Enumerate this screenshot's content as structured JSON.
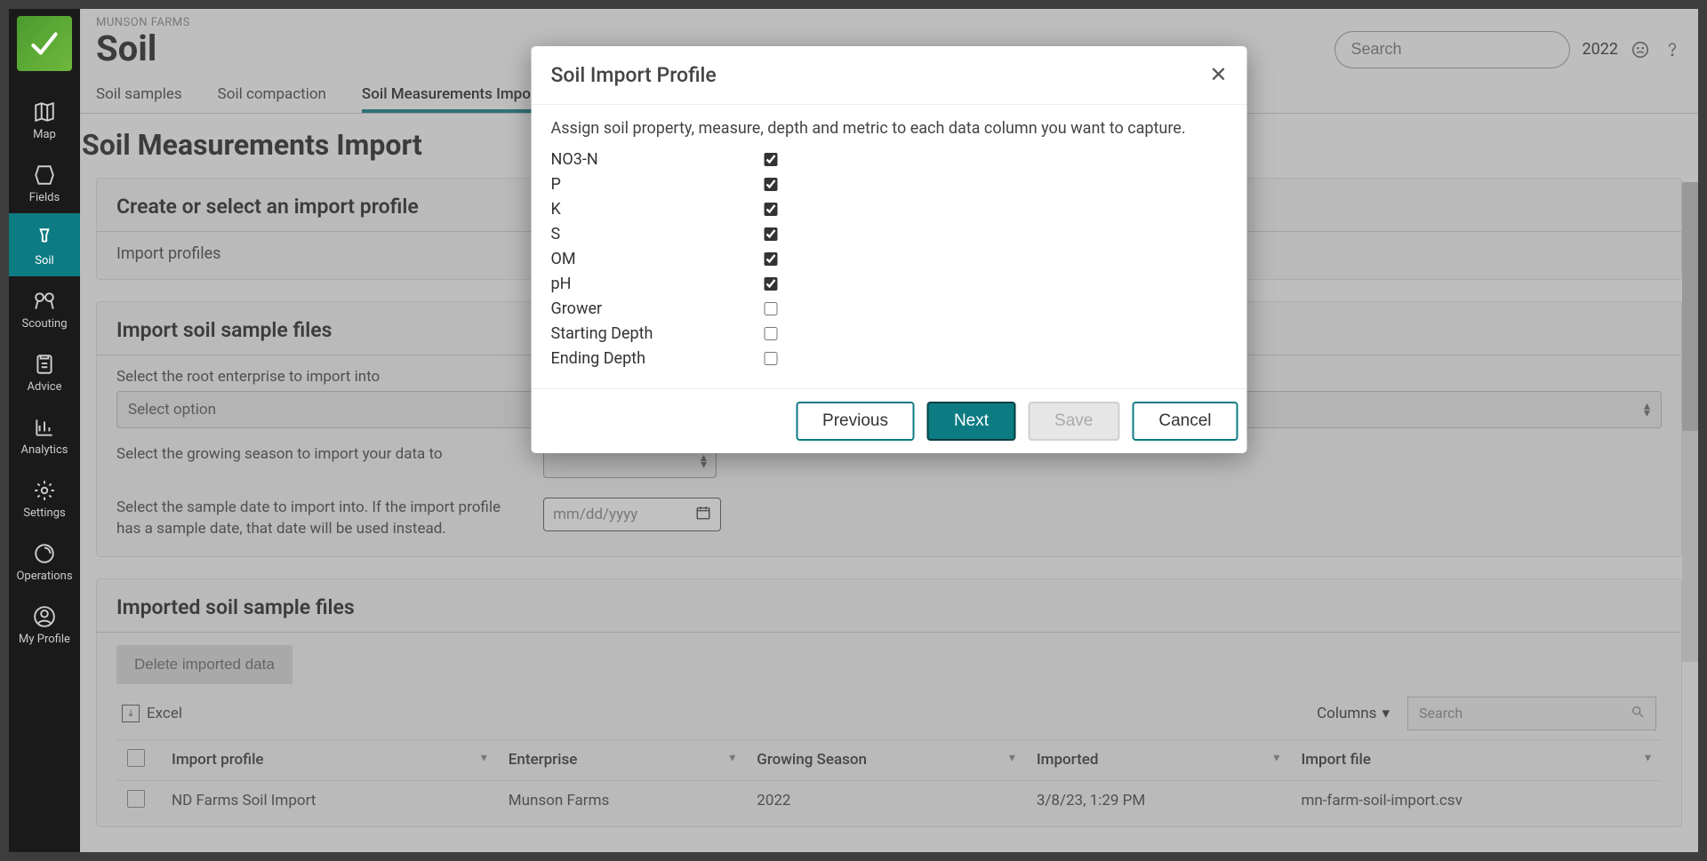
{
  "farmName": "MUNSON FARMS",
  "pageTitle": "Soil",
  "search": {
    "placeholder": "Search",
    "year": "2022"
  },
  "nav": {
    "map": "Map",
    "fields": "Fields",
    "soil": "Soil",
    "scouting": "Scouting",
    "advice": "Advice",
    "analytics": "Analytics",
    "settings": "Settings",
    "operations": "Operations",
    "myprofile": "My Profile"
  },
  "tabs": {
    "samples": "Soil samples",
    "compaction": "Soil compaction",
    "measurements": "Soil Measurements Import"
  },
  "sectionTitle": "Soil Measurements Import",
  "card1": {
    "heading": "Create or select an import profile",
    "sub": "Import profiles"
  },
  "card2": {
    "heading": "Import soil sample files",
    "label1": "Select the root enterprise to import into",
    "select1": "Select option",
    "label2": "Select the growing season to import your data to",
    "label3": "Select the sample date to import into. If the import profile has a sample date, that date will be used instead.",
    "datePlaceholder": "mm/dd/yyyy"
  },
  "card3": {
    "heading": "Imported soil sample files",
    "deleteBtn": "Delete imported data",
    "excel": "Excel",
    "columns": "Columns",
    "tblSearch": "Search",
    "cols": {
      "profile": "Import profile",
      "enterprise": "Enterprise",
      "season": "Growing Season",
      "imported": "Imported",
      "file": "Import file"
    },
    "row1": {
      "profile": "ND Farms Soil Import",
      "enterprise": "Munson Farms",
      "season": "2022",
      "imported": "3/8/23, 1:29 PM",
      "file": "mn-farm-soil-import.csv"
    }
  },
  "modal": {
    "title": "Soil Import Profile",
    "desc": "Assign soil property, measure, depth and metric to each data column you want to capture.",
    "props": [
      {
        "label": "NO3-N",
        "checked": true
      },
      {
        "label": "P",
        "checked": true
      },
      {
        "label": "K",
        "checked": true
      },
      {
        "label": "S",
        "checked": true
      },
      {
        "label": "OM",
        "checked": true
      },
      {
        "label": "pH",
        "checked": true
      },
      {
        "label": "Grower",
        "checked": false
      },
      {
        "label": "Starting Depth",
        "checked": false
      },
      {
        "label": "Ending Depth",
        "checked": false
      }
    ],
    "btnPrev": "Previous",
    "btnNext": "Next",
    "btnSave": "Save",
    "btnCancel": "Cancel"
  }
}
